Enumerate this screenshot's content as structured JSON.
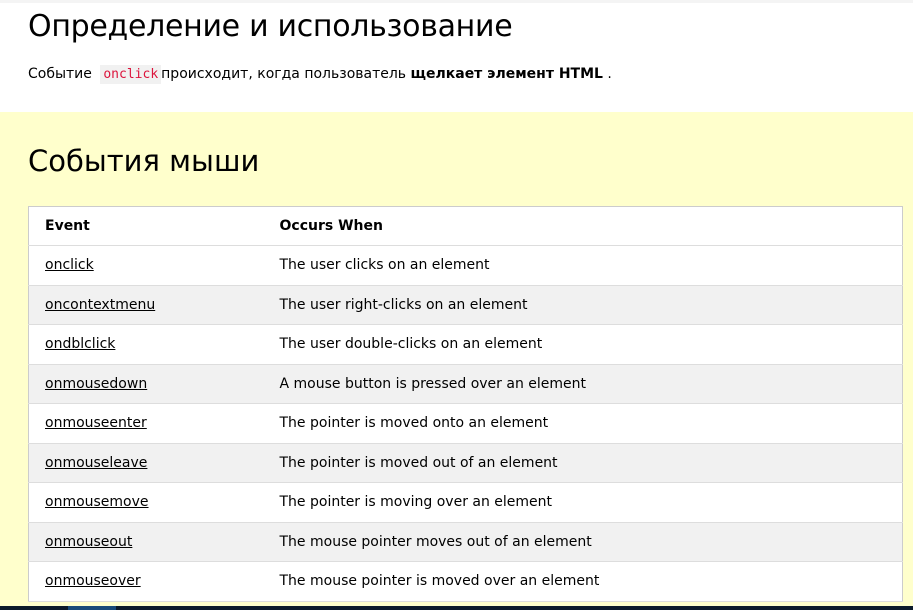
{
  "definition": {
    "title": "Определение и использование",
    "text_before": "Событие",
    "code": "onclick",
    "text_middle": "происходит, когда пользователь",
    "text_bold": "щелкает элемент HTML",
    "text_after": "."
  },
  "mouse_events": {
    "title": "События мыши",
    "headers": [
      "Event",
      "Occurs When"
    ],
    "rows": [
      {
        "event": "onclick",
        "desc": "The user clicks on an element"
      },
      {
        "event": "oncontextmenu",
        "desc": "The user right-clicks on an element"
      },
      {
        "event": "ondblclick",
        "desc": "The user double-clicks on an element"
      },
      {
        "event": "onmousedown",
        "desc": "A mouse button is pressed over an element"
      },
      {
        "event": "onmouseenter",
        "desc": "The pointer is moved onto an element"
      },
      {
        "event": "onmouseleave",
        "desc": "The pointer is moved out of an element"
      },
      {
        "event": "onmousemove",
        "desc": "The pointer is moving over an element"
      },
      {
        "event": "onmouseout",
        "desc": "The mouse pointer moves out of an element"
      },
      {
        "event": "onmouseover",
        "desc": "The mouse pointer is moved over an element"
      }
    ]
  },
  "colors": {
    "section_bg": "#ffffcc",
    "code": "#dc143c",
    "row_alt": "#f1f1f1"
  }
}
